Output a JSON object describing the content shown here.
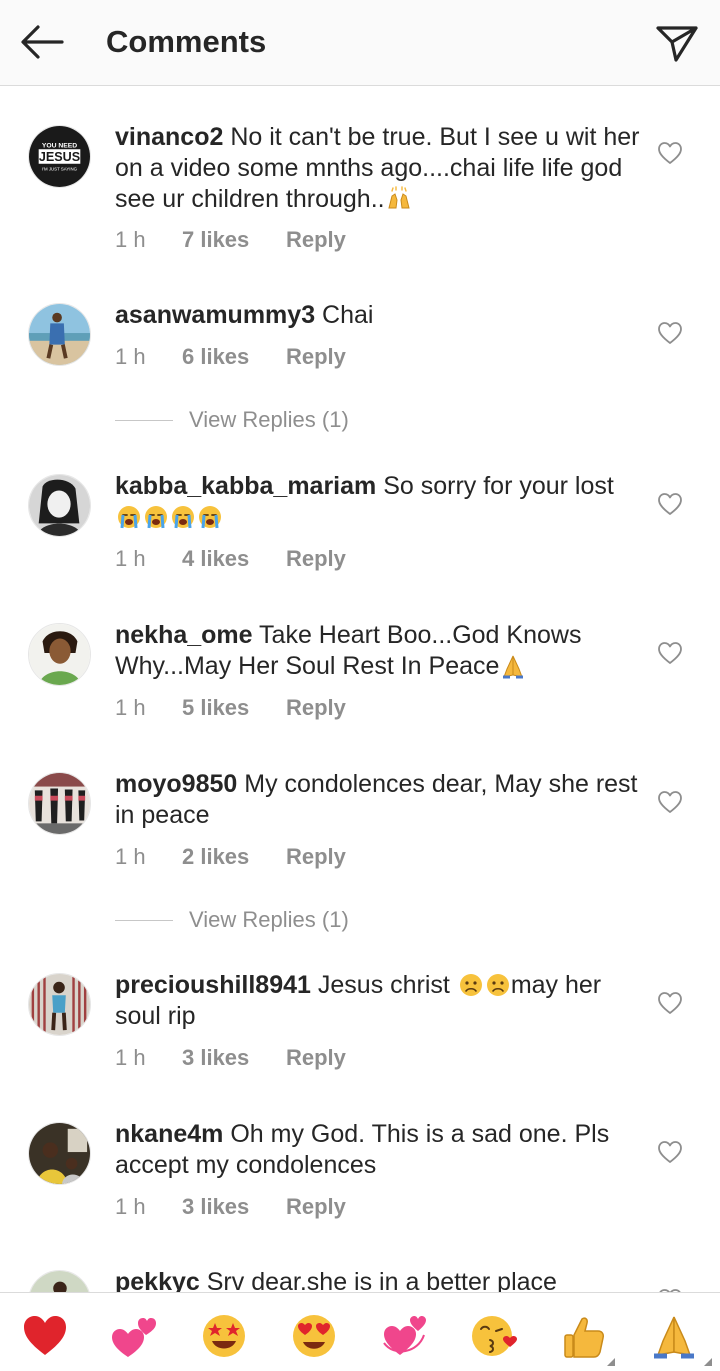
{
  "header": {
    "title": "Comments",
    "back_icon": "arrow-left-icon",
    "share_icon": "paper-plane-icon"
  },
  "comments": [
    {
      "username": "vinanco2",
      "text": " No it can't be true. But I see u wit her on a video some mnths ago....chai life life god see ur children through..",
      "emoji": "raising-hands-icon",
      "time": "1 h",
      "likes": "7 likes",
      "reply": "Reply",
      "avatar_text": "YOU NEED JESUS"
    },
    {
      "username": "asanwamummy3",
      "text": " Chai",
      "time": "1 h",
      "likes": "6 likes",
      "reply": "Reply",
      "view_replies": "View Replies (1)"
    },
    {
      "username": "kabba_kabba_mariam",
      "text": " So sorry for your lost",
      "emoji": "loudly-crying-face-icon x4",
      "time": "1 h",
      "likes": "4 likes",
      "reply": "Reply"
    },
    {
      "username": "nekha_ome",
      "text": " Take Heart Boo...God Knows Why...May Her Soul Rest In Peace",
      "emoji": "folded-hands-icon",
      "time": "1 h",
      "likes": "5 likes",
      "reply": "Reply"
    },
    {
      "username": "moyo9850",
      "text": " My condolences dear, May she rest in peace",
      "time": "1 h",
      "likes": "2 likes",
      "reply": "Reply",
      "view_replies": "View Replies (1)"
    },
    {
      "username": "precioushill8941",
      "text_before": " Jesus christ ",
      "text_after": "may her soul rip",
      "emoji": "worried-face-icon x2",
      "time": "1 h",
      "likes": "3 likes",
      "reply": "Reply"
    },
    {
      "username": "nkane4m",
      "text": " Oh my God. This is a sad one. Pls accept my condolences",
      "time": "1 h",
      "likes": "3 likes",
      "reply": "Reply"
    },
    {
      "username": "pekkyc",
      "text": " Srv dear.she is in a better place"
    }
  ],
  "emoji_bar": [
    "red-heart-icon",
    "two-hearts-icon",
    "star-struck-icon",
    "heart-eyes-icon",
    "revolving-hearts-icon",
    "kissing-heart-icon",
    "thumbs-up-icon",
    "folded-hands-icon"
  ],
  "colors": {
    "text": "#262626",
    "meta": "#8e8e8e",
    "header_bg": "#fafafa",
    "divider": "#dbdbdb"
  }
}
